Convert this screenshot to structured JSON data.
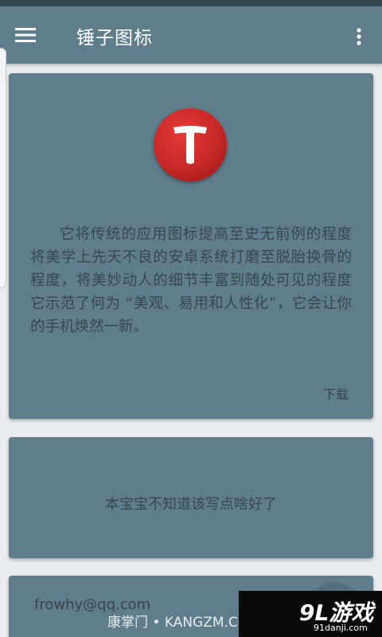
{
  "app_bar": {
    "title": "锤子图标",
    "menu_icon": "hamburger-menu-icon",
    "overflow_icon": "more-vert-icon",
    "color": "#607d8b"
  },
  "cards": {
    "main": {
      "logo_icon": "hammer-t-logo-icon",
      "description": "它将传统的应用图标提高至史无前例的程度将美学上先天不良的安卓系统打磨至脱胎换骨的程度，将美妙动人的细节丰富到随处可见的程度它示范了何为 “美观、易用和人性化”，它会让你的手机焕然一新。",
      "download_label": "下载"
    },
    "second": {
      "text": "本宝宝不知道该写点啥好了"
    },
    "third": {
      "email": "frowhy@qq.com"
    }
  },
  "overlays": {
    "watermark": "康掌门 • KANGZM.COM",
    "brand_name": "9L游戏",
    "brand_url": "91danji.com"
  },
  "colors": {
    "card": "#607d8b",
    "text": "#37474f",
    "logo_red": "#c62828"
  }
}
